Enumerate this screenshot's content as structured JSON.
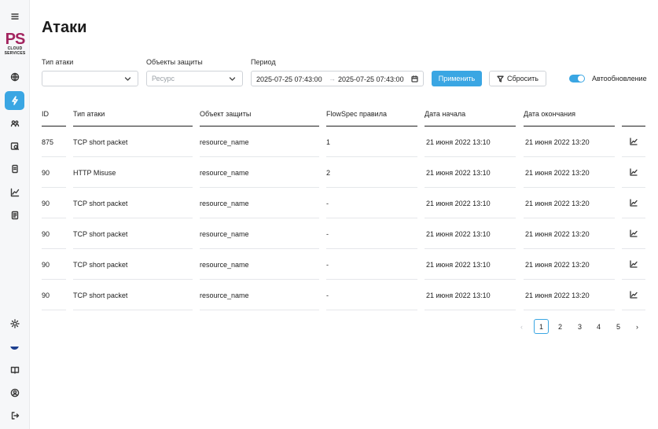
{
  "logo": {
    "mark": "PS",
    "line1": "CLOUD",
    "line2": "SERVICES"
  },
  "sidebar": {
    "icons": [
      "menu-icon",
      "globe-icon",
      "lightning-icon",
      "users-icon",
      "resource-search-icon",
      "document-icon",
      "chart-icon",
      "report-icon",
      "sun-icon",
      "flag-icon",
      "book-icon",
      "profile-icon",
      "logout-icon"
    ],
    "active": "lightning-icon"
  },
  "page": {
    "title": "Атаки"
  },
  "filters": {
    "attack_type": {
      "label": "Тип атаки",
      "value": ""
    },
    "protected_objects": {
      "label": "Объекты защиты",
      "placeholder": "Ресурс"
    },
    "period": {
      "label": "Период",
      "from": "2025-07-25 07:43:00",
      "to": "2025-07-25 07:43:00",
      "separator": "→"
    },
    "apply_label": "Применить",
    "reset_label": "Сбросить",
    "autoupdate_label": "Автообновление",
    "autoupdate_on": true
  },
  "table": {
    "columns": [
      "ID",
      "Тип атаки",
      "Объект защиты",
      "FlowSpec правила",
      "Дата начала",
      "Дата окончания"
    ],
    "rows": [
      {
        "id": "875",
        "type": "TCP short packet",
        "object": "resource_name",
        "flowspec": "1",
        "start": "21 июня 2022 13:10",
        "end": "21 июня 2022 13:20"
      },
      {
        "id": "90",
        "type": "HTTP Misuse",
        "object": "resource_name",
        "flowspec": "2",
        "start": "21 июня 2022 13:10",
        "end": "21 июня 2022 13:20"
      },
      {
        "id": "90",
        "type": "TCP short packet",
        "object": "resource_name",
        "flowspec": "-",
        "start": "21 июня 2022 13:10",
        "end": "21 июня 2022 13:20"
      },
      {
        "id": "90",
        "type": "TCP short packet",
        "object": "resource_name",
        "flowspec": "-",
        "start": "21 июня 2022 13:10",
        "end": "21 июня 2022 13:20"
      },
      {
        "id": "90",
        "type": "TCP short packet",
        "object": "resource_name",
        "flowspec": "-",
        "start": "21 июня 2022 13:10",
        "end": "21 июня 2022 13:20"
      },
      {
        "id": "90",
        "type": "TCP short packet",
        "object": "resource_name",
        "flowspec": "-",
        "start": "21 июня 2022 13:10",
        "end": "21 июня 2022 13:20"
      }
    ]
  },
  "pagination": {
    "prev": "‹",
    "pages": [
      "1",
      "2",
      "3",
      "4",
      "5"
    ],
    "next": "›",
    "current": "1"
  },
  "colors": {
    "accent": "#3aa6e3",
    "brand": "#a3245f",
    "text": "#1f1f1f"
  }
}
